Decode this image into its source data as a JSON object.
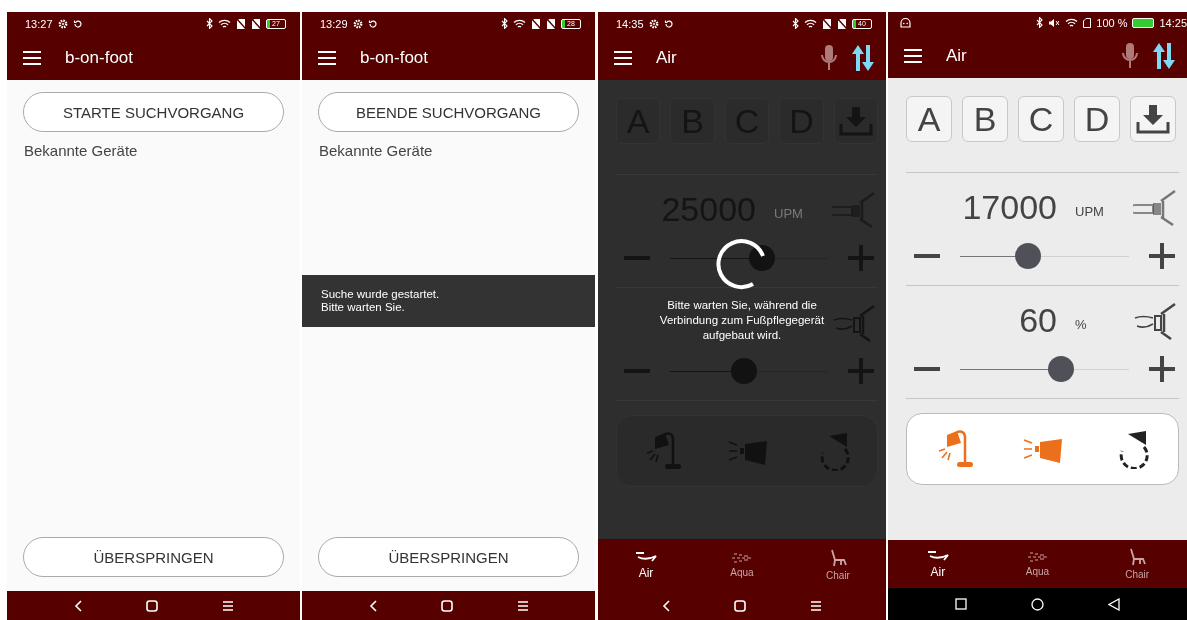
{
  "screens": [
    {
      "kind": "scan",
      "status_bar": {
        "kind": "bar_a",
        "time": "13:27",
        "battery": "27"
      },
      "title": "b-on-foot",
      "scan_button": "STARTE SUCHVORGANG",
      "list_heading": "Bekannte Geräte",
      "skip_button": "ÜBERSPRINGEN",
      "navigation_bar": {
        "kind": "gesture"
      }
    },
    {
      "kind": "scan",
      "status_bar": {
        "kind": "bar_a",
        "time": "13:29",
        "battery": "28"
      },
      "title": "b-on-foot",
      "scan_button": "BEENDE SUCHVORGANG",
      "list_heading": "Bekannte Geräte",
      "skip_button": "ÜBERSPRINGEN",
      "toast": "Suche wurde gestartet.\nBitte warten Sie.",
      "navigation_bar": {
        "kind": "gesture"
      }
    },
    {
      "kind": "control",
      "status_bar": {
        "kind": "bar_a",
        "time": "14:35",
        "battery": "40"
      },
      "title": "Air",
      "presets": [
        "A",
        "B",
        "C",
        "D"
      ],
      "controls": [
        {
          "kind": "handpiece",
          "value": "25000",
          "unit": "UPM",
          "level": 0.58
        },
        {
          "kind": "spray",
          "level": 0.47
        }
      ],
      "tools": [
        {
          "kind": "lamp"
        },
        {
          "kind": "spotlight"
        },
        {
          "kind": "rotation"
        }
      ],
      "loading": "Bitte warten Sie, während die Verbindung zum Fußpflegegerät aufgebaut wird.",
      "tabs": [
        {
          "kind": "air",
          "label": "Air",
          "selected": true
        },
        {
          "kind": "aqua",
          "label": "Aqua",
          "selected": false
        },
        {
          "kind": "chair",
          "label": "Chair",
          "selected": false
        }
      ],
      "navigation_bar": {
        "kind": "gesture"
      }
    },
    {
      "kind": "control",
      "status_bar": {
        "kind": "bar_b",
        "time": "14:25",
        "battery": "100 %"
      },
      "title": "Air",
      "presets": [
        "A",
        "B",
        "C",
        "D"
      ],
      "controls": [
        {
          "kind": "handpiece",
          "value": "17000",
          "unit": "UPM",
          "level": 0.4
        },
        {
          "kind": "spray",
          "value": "60",
          "unit": "%",
          "level": 0.6
        }
      ],
      "tools": [
        {
          "kind": "lamp",
          "active": true
        },
        {
          "kind": "spotlight",
          "active": true
        },
        {
          "kind": "rotation",
          "active": false
        }
      ],
      "tabs": [
        {
          "kind": "air",
          "label": "Air",
          "selected": true
        },
        {
          "kind": "aqua",
          "label": "Aqua",
          "selected": false
        },
        {
          "kind": "chair",
          "label": "Chair",
          "selected": false
        }
      ],
      "navigation_bar": {
        "kind": "android"
      }
    }
  ]
}
